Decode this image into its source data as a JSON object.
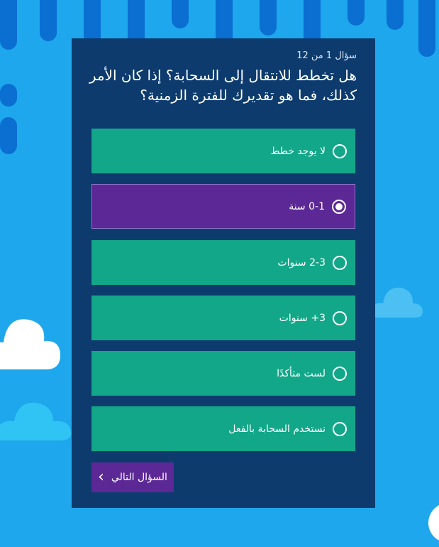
{
  "quiz": {
    "counter": "سؤال 1 من 12",
    "question": "هل تخطط للانتقال إلى السحابة؟ إذا كان الأمر كذلك، فما هو تقديرك للفترة الزمنية؟",
    "options": [
      {
        "label": "لا يوجد خطط",
        "selected": false
      },
      {
        "label": "0-1 سنة",
        "selected": true
      },
      {
        "label": "2-3 سنوات",
        "selected": false
      },
      {
        "label": "3+ سنوات",
        "selected": false
      },
      {
        "label": "لست متأكدًا",
        "selected": false
      },
      {
        "label": "نستخدم السحابة بالفعل",
        "selected": false
      }
    ],
    "next_label": "السؤال التالي"
  },
  "colors": {
    "background": "#1ea7ec",
    "card": "#0d3b6e",
    "option": "#12a788",
    "selected": "#5c2896"
  }
}
